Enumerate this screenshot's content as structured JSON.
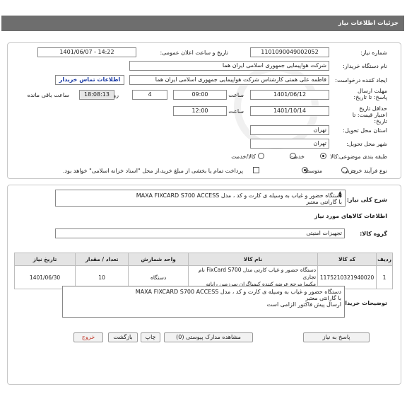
{
  "window_title": "جزئیات اطلاعات نیاز",
  "fields": {
    "need_number_label": "شماره نیاز:",
    "need_number": "1101090049002052",
    "announce_label": "تاریخ و ساعت اعلان عمومی:",
    "announce_value": "1401/06/07 - 14:22",
    "buyer_label": "نام دستگاه خریدار:",
    "buyer_value": "شرکت هواپیمایی جمهوری اسلامی ایران هما",
    "creator_label": "ایجاد کننده درخواست:",
    "creator_value": "فاطمه علی همتی کارشناس شرکت هواپیمایی جمهوری اسلامی ایران هما",
    "contact_link": "اطلاعات تماس خریدار",
    "deadline_label": "مهلت ارسال پاسخ: تا تاریخ:",
    "deadline_date": "1401/06/12",
    "time_label": "ساعت",
    "deadline_time": "09:00",
    "days_value": "4",
    "days_label": "روز و",
    "remaining_time": "18:08:13",
    "remaining_label": "ساعت باقی مانده",
    "validity_label": "حداقل تاریخ اعتبار قیمت: تا تاریخ:",
    "validity_date": "1401/10/14",
    "validity_time_label": "ساعت",
    "validity_time": "12:00",
    "province_label": "استان محل تحویل:",
    "province_value": "تهران",
    "city_label": "شهر محل تحویل:",
    "city_value": "تهران",
    "category_label": "طبقه بندی موضوعی:",
    "category_options": [
      "کالا",
      "خدمت",
      "کالا/خدمت"
    ],
    "process_label": "نوع فرآیند خرید :",
    "process_options": [
      "جزیی",
      "متوسط"
    ],
    "payment_note": "پرداخت تمام یا بخشی از مبلغ خرید،از محل \"اسناد خزانه اسلامی\" خواهد بود."
  },
  "description": {
    "label": "شرح کلی نیاز:",
    "line1": "دستگاه حضور و غیاب به وسیله ی کارت و کد ، مدل MAXA FIXCARD S700 ACCESS",
    "line2": "با گارانتی معتبر"
  },
  "goods_info_title": "اطلاعات کالاهای مورد نیاز",
  "goods_group_label": "گروه کالا:",
  "goods_group_value": "تجهیزات امنیتی",
  "table": {
    "headers": [
      "ردیف",
      "کد کالا",
      "نام کالا",
      "واحد شمارش",
      "تعداد / مقدار",
      "تاریخ نیاز"
    ],
    "rows": [
      {
        "row": "1",
        "code": "1175210321940020",
        "name_line1": "دستگاه حضور و غیاب کارتی مدل FixCard S700 نام تجاری",
        "name_line2": "مکسا مرجع عرضه کننده کیمیاگران سرزمین رایانه",
        "unit": "دستگاه",
        "qty": "10",
        "date": "1401/06/30"
      }
    ]
  },
  "buyer_notes": {
    "label": "توضیحات خریدار:",
    "line1": "دستگاه حضور و غیاب به وسیله ی کارت و کد ، مدل MAXA FIXCARD S700 ACCESS",
    "line2": "با گارانتی معتبر",
    "line3": "ارسال پیش فاکتور الزامی است"
  },
  "buttons": {
    "reply": "پاسخ به نیاز",
    "attachments": "مشاهده مدارک پیوستی (0)",
    "print": "چاپ",
    "back": "بازگشت",
    "exit": "خروج"
  },
  "colors": {
    "titlebar": "#6e6e6e",
    "link": "#1a3aa5",
    "exit_text": "#c0392b"
  }
}
